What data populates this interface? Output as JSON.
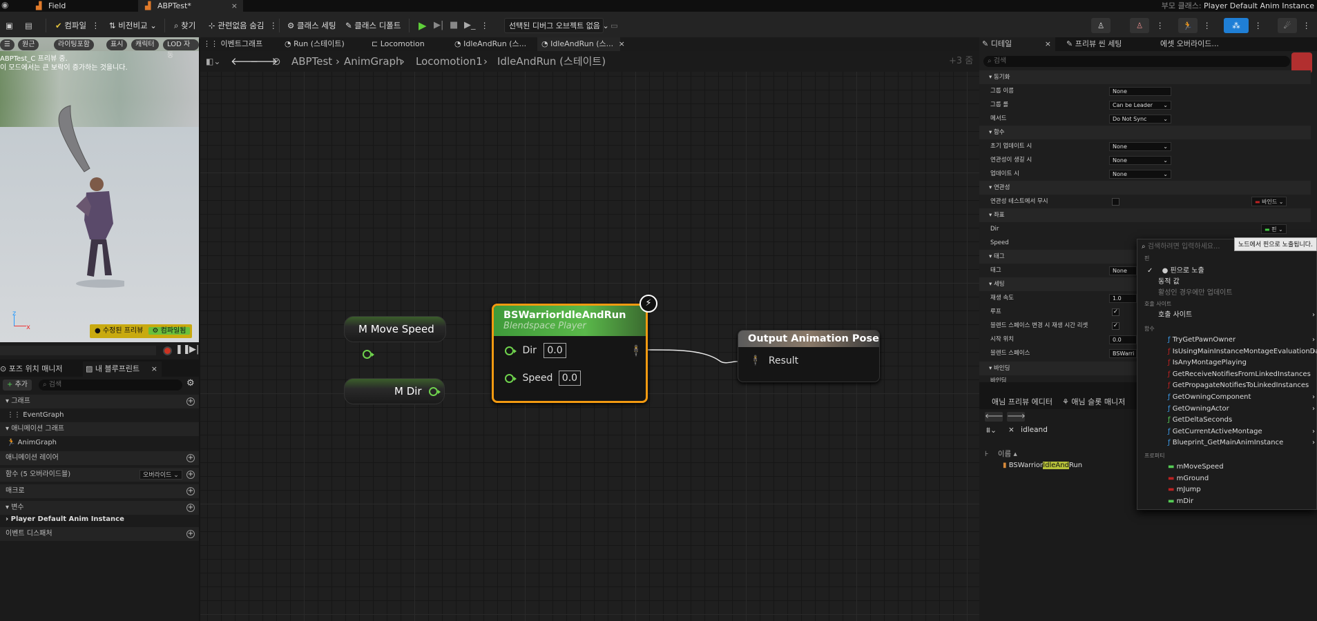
{
  "titlebar": {
    "tabs": [
      {
        "label": "Field"
      },
      {
        "label": "ABPTest*"
      }
    ],
    "parent_class_label": "부모 클래스:",
    "parent_class_value": "Player Default Anim Instance"
  },
  "toolbar": {
    "compile": "컴파일",
    "diff": "비전비교",
    "find": "찾기",
    "hide_unrelated": "관련없음 숨김",
    "class_settings": "클래스 세팅",
    "class_defaults": "클래스 디폴트",
    "debug_object": "선택된 디버그 오브젝트 없음"
  },
  "viewport": {
    "buttons": [
      "원근",
      "라이팅포함",
      "표시",
      "캐릭터",
      "LOD 자동"
    ],
    "overlay_line1": "ABPTest_C 프리뷰 중.",
    "overlay_line2": "이 모드에서는 큰 보락이 증가하는 것을니다.",
    "badge_preview": "수정된 프리뷰",
    "badge_compile": "컴파일됨"
  },
  "left_panel": {
    "tabs": [
      "포즈 위치 매니저",
      "내 블루프린트"
    ],
    "add_label": "추가",
    "search_placeholder": "검색",
    "sections": {
      "graphs": "그래프",
      "event_graph": "EventGraph",
      "anim_graphs": "애니메이션 그래프",
      "anim_graph": "AnimGraph",
      "anim_layers": "애니메이션 레이어",
      "functions": "함수 (5 오버라이드블)",
      "override": "오버라이드",
      "macros": "매크로",
      "variables": "변수",
      "player_default": "Player Default Anim Instance",
      "event_dispatchers": "이벤트 디스패처"
    }
  },
  "graph": {
    "tabs": [
      "이벤트그래프",
      "Run (스테이트)",
      "Locomotion",
      "IdleAndRun (스...",
      "IdleAndRun (스..."
    ],
    "breadcrumb": [
      "ABPTest",
      "AnimGraph",
      "Locomotion1",
      "IdleAndRun (스테이트)"
    ],
    "zoom_label": "+3 줌",
    "nodes": {
      "move_speed": "M Move Speed",
      "dir": "M Dir",
      "blendspace_title": "BSWarriorIdleAndRun",
      "blendspace_subtitle": "Blendspace Player",
      "pin_dir": "Dir",
      "pin_dir_value": "0.0",
      "pin_speed": "Speed",
      "pin_speed_value": "0.0",
      "output_title": "Output Animation Pose",
      "output_pin": "Result"
    }
  },
  "details": {
    "tabs": [
      "디테일",
      "프리뷰 씬 세팅",
      "에셋 오버라이드..."
    ],
    "search_placeholder": "검색",
    "sections": {
      "sync": "동기화",
      "group_name": "그룹 이름",
      "group_name_val": "None",
      "group_role": "그룹 롤",
      "group_role_val": "Can be Leader",
      "method": "메서드",
      "method_val": "Do Not Sync",
      "functions": "함수",
      "on_initial_update": "초기 업데이트 시",
      "on_initial_update_val": "None",
      "on_become_relevant": "연관성이 생길 시",
      "on_become_relevant_val": "None",
      "on_update": "업데이트 시",
      "on_update_val": "None",
      "relevancy": "연관성",
      "ignore_relevancy": "연관성 테스트에서 무시",
      "bind_label": "바인드",
      "coordinates": "좌표",
      "dir": "Dir",
      "dir_bind": "핀",
      "speed": "Speed",
      "tag": "태그",
      "tag_row": "태그",
      "tag_val": "None",
      "settings": "세팅",
      "play_rate": "재생 속도",
      "play_rate_val": "1.0",
      "loop": "루프",
      "reset_on_change": "블렌드 스페이스 변경 시 재생 시간 리셋",
      "start_pos": "시작 위치",
      "start_pos_val": "0.0",
      "blendspace": "블렌드 스페이스",
      "blendspace_val": "BSWarri",
      "binding": "바인딩",
      "binding_row": "바인딩"
    }
  },
  "asset_browser": {
    "tabs": [
      "애님 프리뷰 에디터",
      "애님 슬롯 매니저"
    ],
    "search_value": "idleand",
    "column_name": "이름",
    "result_pre": "BSWarrior",
    "result_highlight": "IdleAnd",
    "result_post": "Run"
  },
  "dropdown": {
    "search_placeholder": "검색하려면 입력하세요...",
    "pin_label": "핀",
    "expose_as_pin": "핀으로 노출",
    "dynamic_value": "동적 값",
    "update_when_active": "활성인 경우에만 업데이트",
    "call_site_header": "호출 사이트",
    "call_site": "호출 사이트",
    "functions_header": "함수",
    "functions": [
      "TryGetPawnOwner",
      "IsUsingMainInstanceMontageEvaluationData",
      "IsAnyMontagePlaying",
      "GetReceiveNotifiesFromLinkedInstances",
      "GetPropagateNotifiesToLinkedInstances",
      "GetOwningComponent",
      "GetOwningActor",
      "GetDeltaSeconds",
      "GetCurrentActiveMontage",
      "Blueprint_GetMainAnimInstance"
    ],
    "properties_header": "프로퍼티",
    "properties": [
      "mMoveSpeed",
      "mGround",
      "mJump",
      "mDir"
    ]
  },
  "tooltip": "노드에서 핀으로 노출됩니다."
}
